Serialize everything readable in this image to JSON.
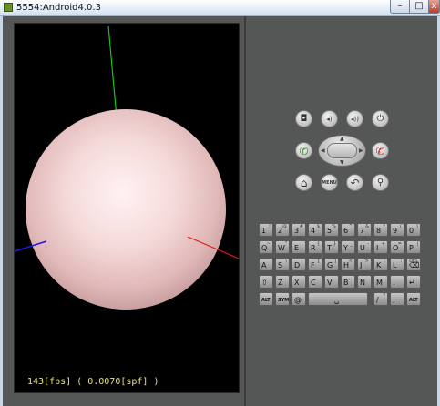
{
  "window": {
    "title": "5554:Android4.0.3",
    "minimize_glyph": "–",
    "maximize_glyph": "□",
    "close_glyph": "x"
  },
  "screen": {
    "fps_text": "143[fps] ( 0.0070[spf] )",
    "background": "#000000",
    "sphere_color": "#f2d4d4",
    "axis_colors": {
      "x": "#e01a1a",
      "y": "#19c219",
      "z": "#1a1ae0"
    }
  },
  "controls": {
    "top_row": [
      {
        "name": "camera-icon",
        "glyph": "◘"
      },
      {
        "name": "volume-down-icon",
        "glyph": "◂)"
      },
      {
        "name": "volume-up-icon",
        "glyph": "◂))"
      },
      {
        "name": "power-icon",
        "glyph": "⏻"
      }
    ],
    "call_glyph": "✆",
    "end_call_glyph": "✆",
    "dpad_arrows": {
      "up": "▲",
      "down": "▼",
      "left": "◀",
      "right": "▶"
    },
    "bottom_row": [
      {
        "name": "home-icon",
        "glyph": "⌂"
      },
      {
        "name": "menu-button",
        "glyph": "MENU"
      },
      {
        "name": "back-icon",
        "glyph": "↶"
      },
      {
        "name": "search-icon",
        "glyph": "⚲"
      }
    ]
  },
  "keyboard": {
    "rows": [
      [
        {
          "main": "1",
          "alt": "!"
        },
        {
          "main": "2",
          "alt": "@"
        },
        {
          "main": "3",
          "alt": "#"
        },
        {
          "main": "4",
          "alt": "$"
        },
        {
          "main": "5",
          "alt": "%"
        },
        {
          "main": "6",
          "alt": "^"
        },
        {
          "main": "7",
          "alt": "&"
        },
        {
          "main": "8",
          "alt": "*"
        },
        {
          "main": "9",
          "alt": "("
        },
        {
          "main": "0",
          "alt": ")"
        }
      ],
      [
        {
          "main": "Q",
          "alt": "~"
        },
        {
          "main": "W",
          "alt": "\""
        },
        {
          "main": "E",
          "alt": "`"
        },
        {
          "main": "R",
          "alt": "{"
        },
        {
          "main": "T",
          "alt": "}"
        },
        {
          "main": "Y",
          "alt": "_"
        },
        {
          "main": "U",
          "alt": "-"
        },
        {
          "main": "I",
          "alt": "+"
        },
        {
          "main": "O",
          "alt": "="
        },
        {
          "main": "P",
          "alt": "|"
        }
      ],
      [
        {
          "main": "A",
          "alt": ""
        },
        {
          "main": "S",
          "alt": "\\"
        },
        {
          "main": "D",
          "alt": ""
        },
        {
          "main": "F",
          "alt": "["
        },
        {
          "main": "G",
          "alt": "]"
        },
        {
          "main": "H",
          "alt": "<"
        },
        {
          "main": "J",
          "alt": ">"
        },
        {
          "main": "K",
          "alt": ";"
        },
        {
          "main": "L",
          "alt": ":"
        },
        {
          "main": "⌫",
          "alt": "DEL"
        }
      ],
      [
        {
          "main": "⇧",
          "alt": ""
        },
        {
          "main": "Z",
          "alt": ""
        },
        {
          "main": "X",
          "alt": ""
        },
        {
          "main": "C",
          "alt": ""
        },
        {
          "main": "V",
          "alt": ""
        },
        {
          "main": "B",
          "alt": ""
        },
        {
          "main": "N",
          "alt": ""
        },
        {
          "main": "M",
          "alt": ""
        },
        {
          "main": ".",
          "alt": ""
        },
        {
          "main": "↵",
          "alt": ""
        }
      ],
      [
        {
          "main": "ALT",
          "alt": ""
        },
        {
          "main": "SYM",
          "alt": ""
        },
        {
          "main": "@",
          "alt": ""
        },
        {
          "main": "␣",
          "alt": ""
        },
        {
          "main": "/",
          "alt": "?"
        },
        {
          "main": ",",
          "alt": ""
        },
        {
          "main": "ALT",
          "alt": ""
        }
      ]
    ]
  }
}
